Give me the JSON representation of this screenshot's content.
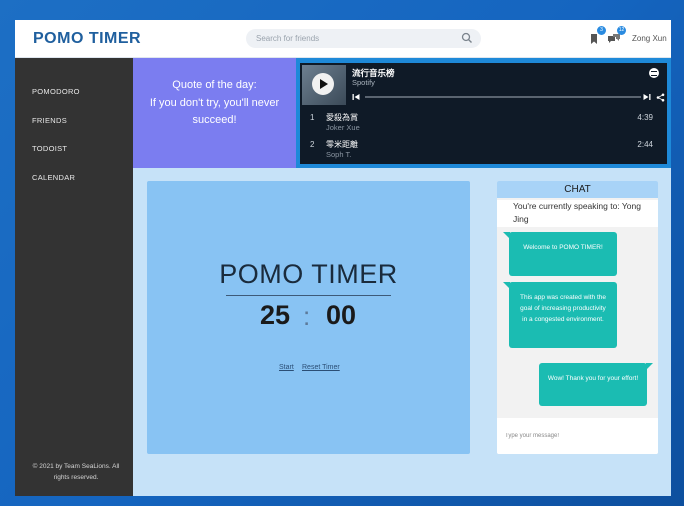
{
  "header": {
    "logo": "POMO TIMER",
    "search_placeholder": "Search for friends",
    "bookmark_badge": "3",
    "chat_badge": "12",
    "user_name": "Zong Xun"
  },
  "sidebar": {
    "items": [
      {
        "label": "POMODORO"
      },
      {
        "label": "FRIENDS"
      },
      {
        "label": "TODOIST"
      },
      {
        "label": "CALENDAR"
      }
    ],
    "footer": "© 2021 by Team SeaLions. All rights reserved."
  },
  "quote": {
    "heading": "Quote of the day:",
    "text": "If you don't try, you'll never succeed!"
  },
  "spotify": {
    "playlist_title": "流行音乐榜",
    "provider": "Spotify",
    "tracks": [
      {
        "num": "1",
        "name": "愛殺為賞",
        "artist": "Joker Xue",
        "time": "4:39"
      },
      {
        "num": "2",
        "name": "零米距離",
        "artist": "Soph T.",
        "time": "2:44"
      }
    ]
  },
  "timer": {
    "title": "POMO TIMER",
    "minutes": "25",
    "separator": ":",
    "seconds": "00",
    "start_label": "Start",
    "reset_label": "Reset Timer"
  },
  "chat": {
    "title": "CHAT",
    "speaking_to": "You're currently speaking to: Yong Jing",
    "messages": [
      {
        "text": "Welcome to POMO TIMER!"
      },
      {
        "text": "This app was created with the goal of increasing productivity in a congested environment."
      },
      {
        "text": "Wow! Thank you for your effort!"
      }
    ],
    "input_placeholder": "Type your message!"
  },
  "colors": {
    "quote_bg": "#7b7df0",
    "timer_card": "#88c3f3",
    "chat_bubble": "#1bbcb2",
    "sidebar": "#333333",
    "logo": "#1f5f9e"
  }
}
